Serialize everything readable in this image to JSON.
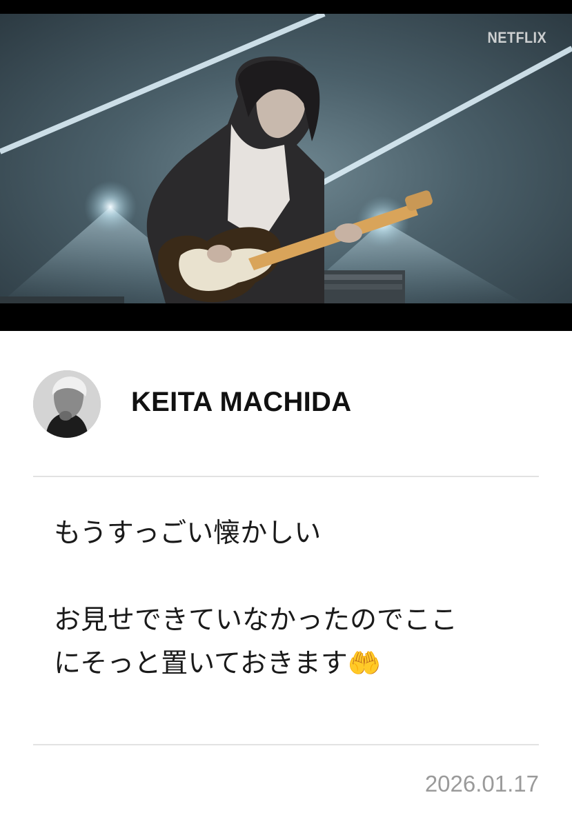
{
  "video": {
    "watermark": "NETFLIX",
    "description_icon": "video-frame"
  },
  "author": {
    "name": "KEITA MACHIDA",
    "avatar_icon": "profile-photo"
  },
  "post": {
    "line1": "もうすっごい懐かしい",
    "line2": "お見せできていなかったのでここ",
    "line3": "にそっと置いておきます🤲"
  },
  "date": "2026.01.17",
  "colors": {
    "background": "#ffffff",
    "text": "#1a1a1a",
    "divider": "#e2e2e2",
    "date": "#9a9a9a"
  }
}
